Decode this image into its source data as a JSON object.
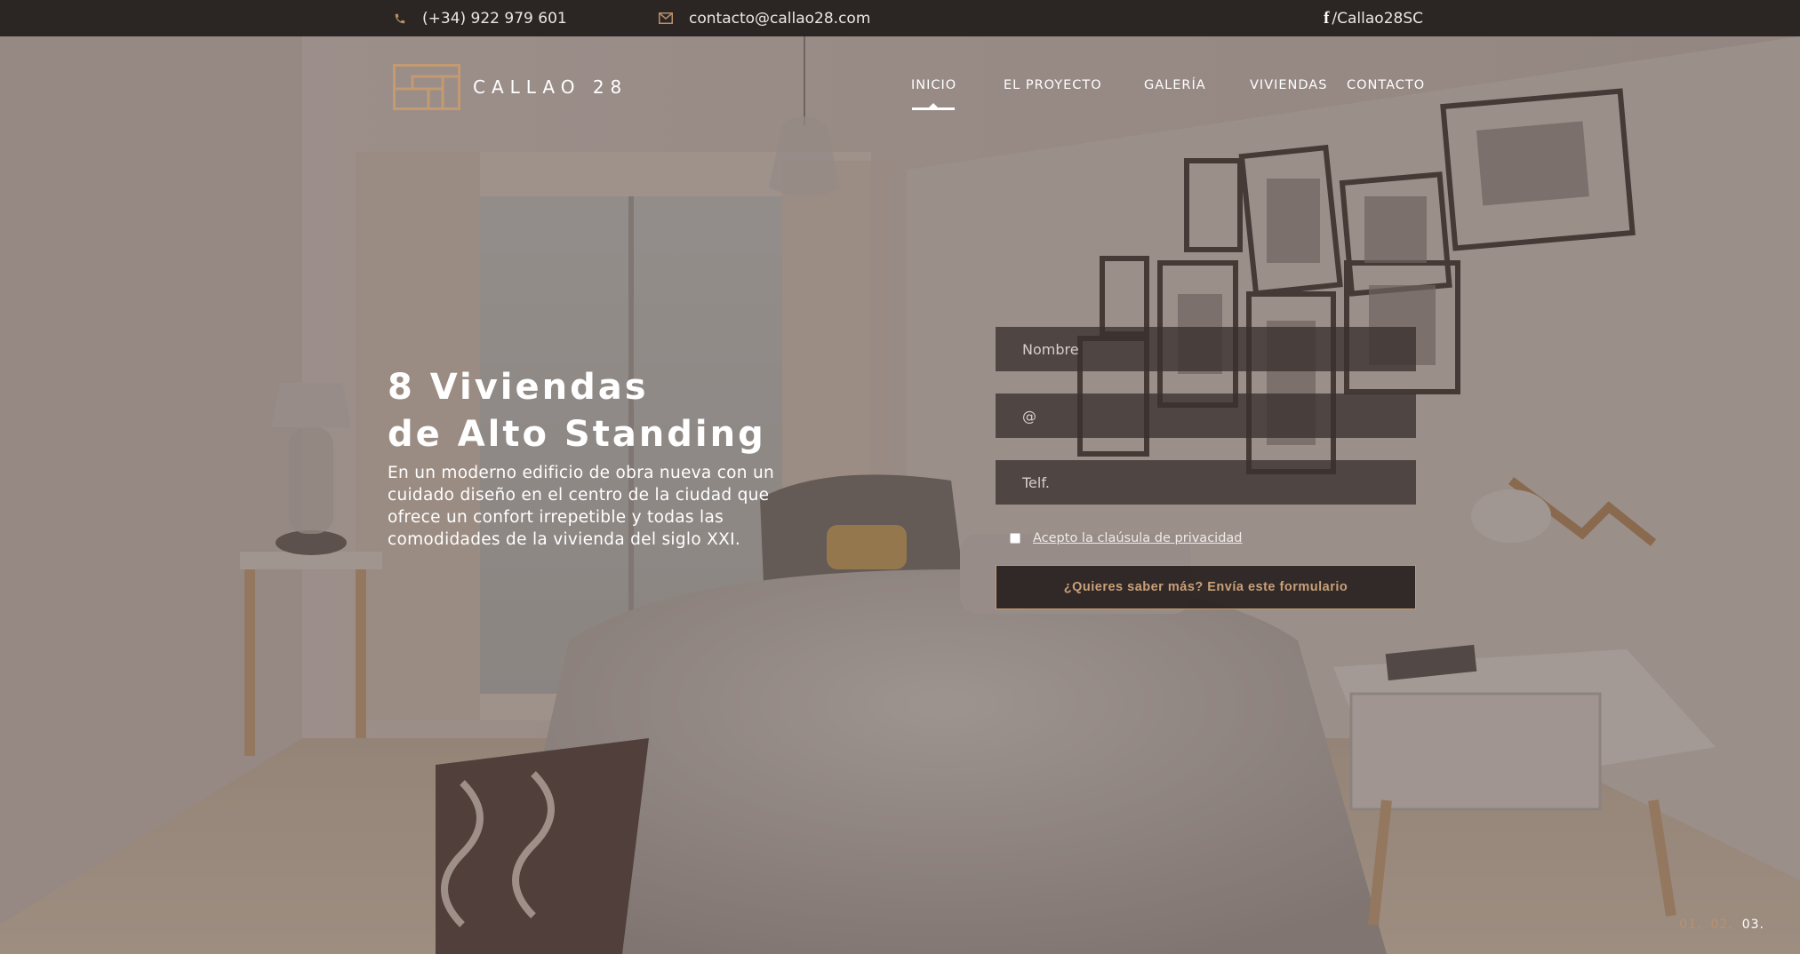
{
  "topbar": {
    "phone": "(+34) 922 979 601",
    "email": "contacto@callao28.com",
    "facebook": "/Callao28SC",
    "phone_icon": "phone-icon",
    "email_icon": "envelope-icon",
    "facebook_icon": "facebook-icon"
  },
  "brand": {
    "name": "CALLAO 28",
    "accent": "#c39a72"
  },
  "nav": {
    "items": [
      {
        "label": "INICIO",
        "active": true
      },
      {
        "label": "EL PROYECTO",
        "active": false
      },
      {
        "label": "GALERÍA",
        "active": false
      },
      {
        "label": "VIVIENDAS",
        "active": false
      },
      {
        "label": "CONTACTO",
        "active": false
      }
    ]
  },
  "hero": {
    "title_line1": "8 Viviendas",
    "title_line2": "de Alto Standing",
    "subtitle": "En un moderno edificio de obra nueva con un cuidado diseño en el centro de la ciudad que ofrece un confort irrepetible y todas las comodidades de la vivienda del siglo XXI."
  },
  "form": {
    "name_placeholder": "Nombre",
    "email_placeholder": "@",
    "phone_placeholder": "Telf.",
    "privacy_label": "Acepto la claúsula de privacidad",
    "submit_label": "¿Quieres saber más? Envía este formulario"
  },
  "pager": {
    "slides": [
      "01.",
      "02.",
      "03."
    ],
    "current": "03."
  }
}
